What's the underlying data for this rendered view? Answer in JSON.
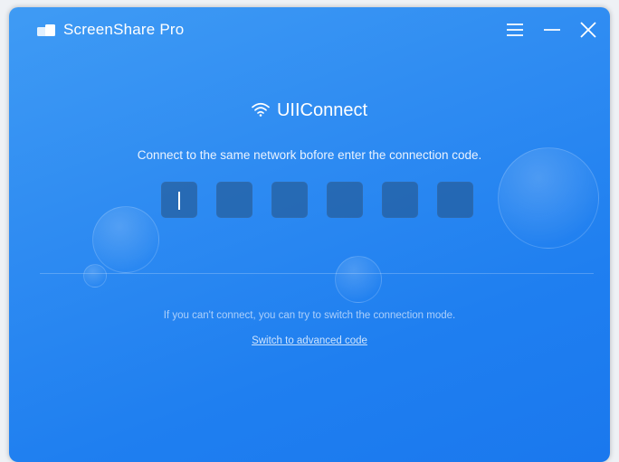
{
  "app": {
    "title": "ScreenShare Pro",
    "logo_icon": "screen-share-logo-icon"
  },
  "window_controls": {
    "menu_icon": "hamburger-menu-icon",
    "minimize_icon": "minimize-icon",
    "close_icon": "close-icon"
  },
  "connect": {
    "wifi_icon": "wifi-icon",
    "title": "UIIConnect",
    "instruction": "Connect to the same network bofore enter the connection code.",
    "code_boxes": [
      "",
      "",
      "",
      "",
      "",
      ""
    ],
    "active_box_index": 0
  },
  "footer": {
    "hint": "If you can't connect, you can try to switch the connection mode.",
    "switch_link": "Switch to advanced code"
  },
  "colors": {
    "background_start": "#3f9bf4",
    "background_end": "#1a78ee",
    "code_box": "#23507f",
    "text": "#ffffff"
  }
}
